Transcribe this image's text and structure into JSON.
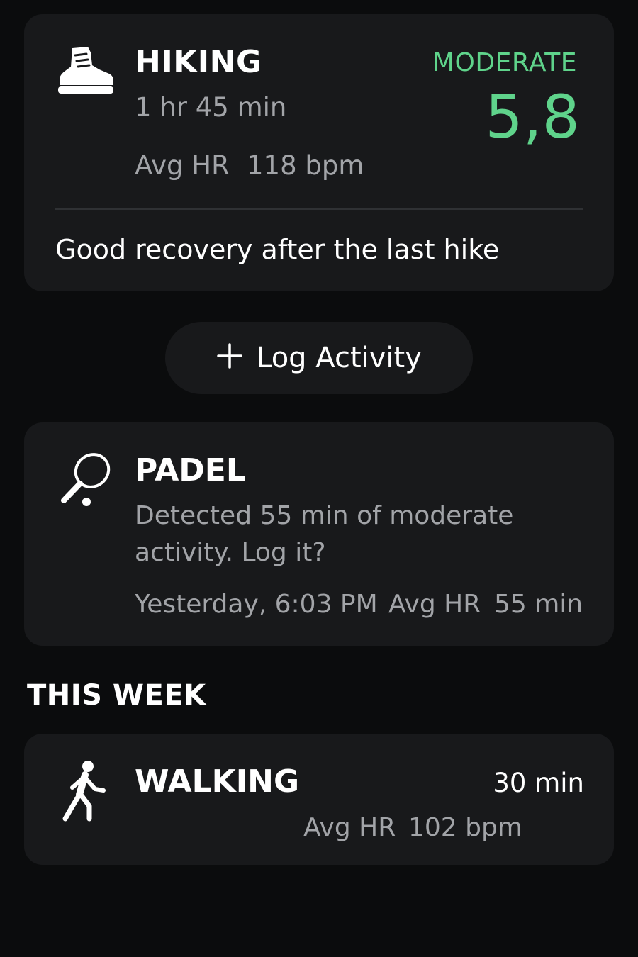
{
  "cards": {
    "hiking": {
      "icon": "hiking-boot-icon",
      "title": "HIKING",
      "duration": "1 hr 45 min",
      "hr_label": "Avg HR",
      "hr_value": "118 bpm",
      "intensity": "MODERATE",
      "score": "5,8",
      "note": "Good recovery after the last hike"
    },
    "padel": {
      "icon": "padel-racket-icon",
      "title": "PADEL",
      "description": "Detected 55 min of moderate activity. Log it?",
      "time": "Yesterday, 6:03 PM",
      "hr_label": "Avg HR",
      "duration": "55 min"
    },
    "walking": {
      "icon": "walking-person-icon",
      "title": "WALKING",
      "duration": "30 min",
      "hr_label": "Avg HR",
      "hr_value": "102 bpm"
    }
  },
  "log_button": {
    "icon": "plus-icon",
    "label": "Log Activity"
  },
  "section": {
    "this_week": "THIS WEEK"
  },
  "colors": {
    "background": "#0b0c0d",
    "card": "#18191b",
    "accent_green": "#5fd38b",
    "muted_text": "#a2a4a8"
  }
}
